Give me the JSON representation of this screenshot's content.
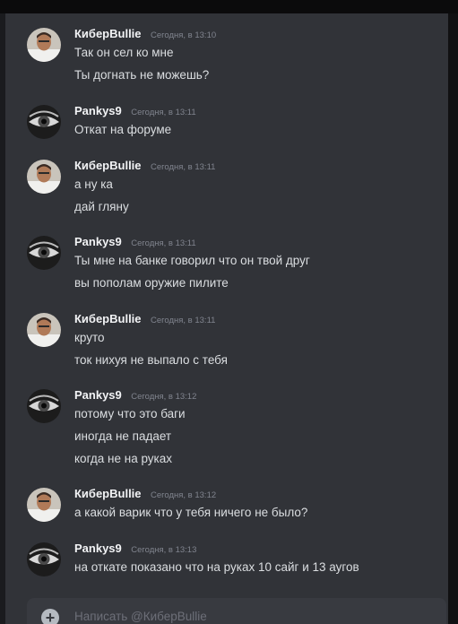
{
  "composer": {
    "placeholder": "Написать @КиберBullie"
  },
  "messages": [
    {
      "author": "КиберBullie",
      "time": "Сегодня, в 13:10",
      "avatar": "user-photo-avatar",
      "lines": [
        "Так он сел ко мне",
        "Ты догнать не можешь?"
      ]
    },
    {
      "author": "Pankys9",
      "time": "Сегодня, в 13:11",
      "avatar": "eye-avatar",
      "lines": [
        "Откат на форуме"
      ]
    },
    {
      "author": "КиберBullie",
      "time": "Сегодня, в 13:11",
      "avatar": "user-photo-avatar",
      "lines": [
        "а ну ка",
        "дай гляну"
      ]
    },
    {
      "author": "Pankys9",
      "time": "Сегодня, в 13:11",
      "avatar": "eye-avatar",
      "lines": [
        "Ты мне на банке говорил что он твой друг",
        "вы пополам оружие пилите"
      ]
    },
    {
      "author": "КиберBullie",
      "time": "Сегодня, в 13:11",
      "avatar": "user-photo-avatar",
      "lines": [
        "круто",
        "ток нихуя не выпало с тебя"
      ]
    },
    {
      "author": "Pankys9",
      "time": "Сегодня, в 13:12",
      "avatar": "eye-avatar",
      "lines": [
        "потому что это баги",
        "иногда не падает",
        "когда не на руках"
      ]
    },
    {
      "author": "КиберBullie",
      "time": "Сегодня, в 13:12",
      "avatar": "user-photo-avatar",
      "lines": [
        "а какой варик что у тебя ничего не было?"
      ]
    },
    {
      "author": "Pankys9",
      "time": "Сегодня, в 13:13",
      "avatar": "eye-avatar",
      "lines": [
        "на откате показано что на руках 10 сайг и 13 аугов"
      ]
    }
  ],
  "colors": {
    "background": "#313338",
    "author": "#f2f3f5",
    "message_text": "#dbdee1",
    "timestamp": "#80848e"
  }
}
